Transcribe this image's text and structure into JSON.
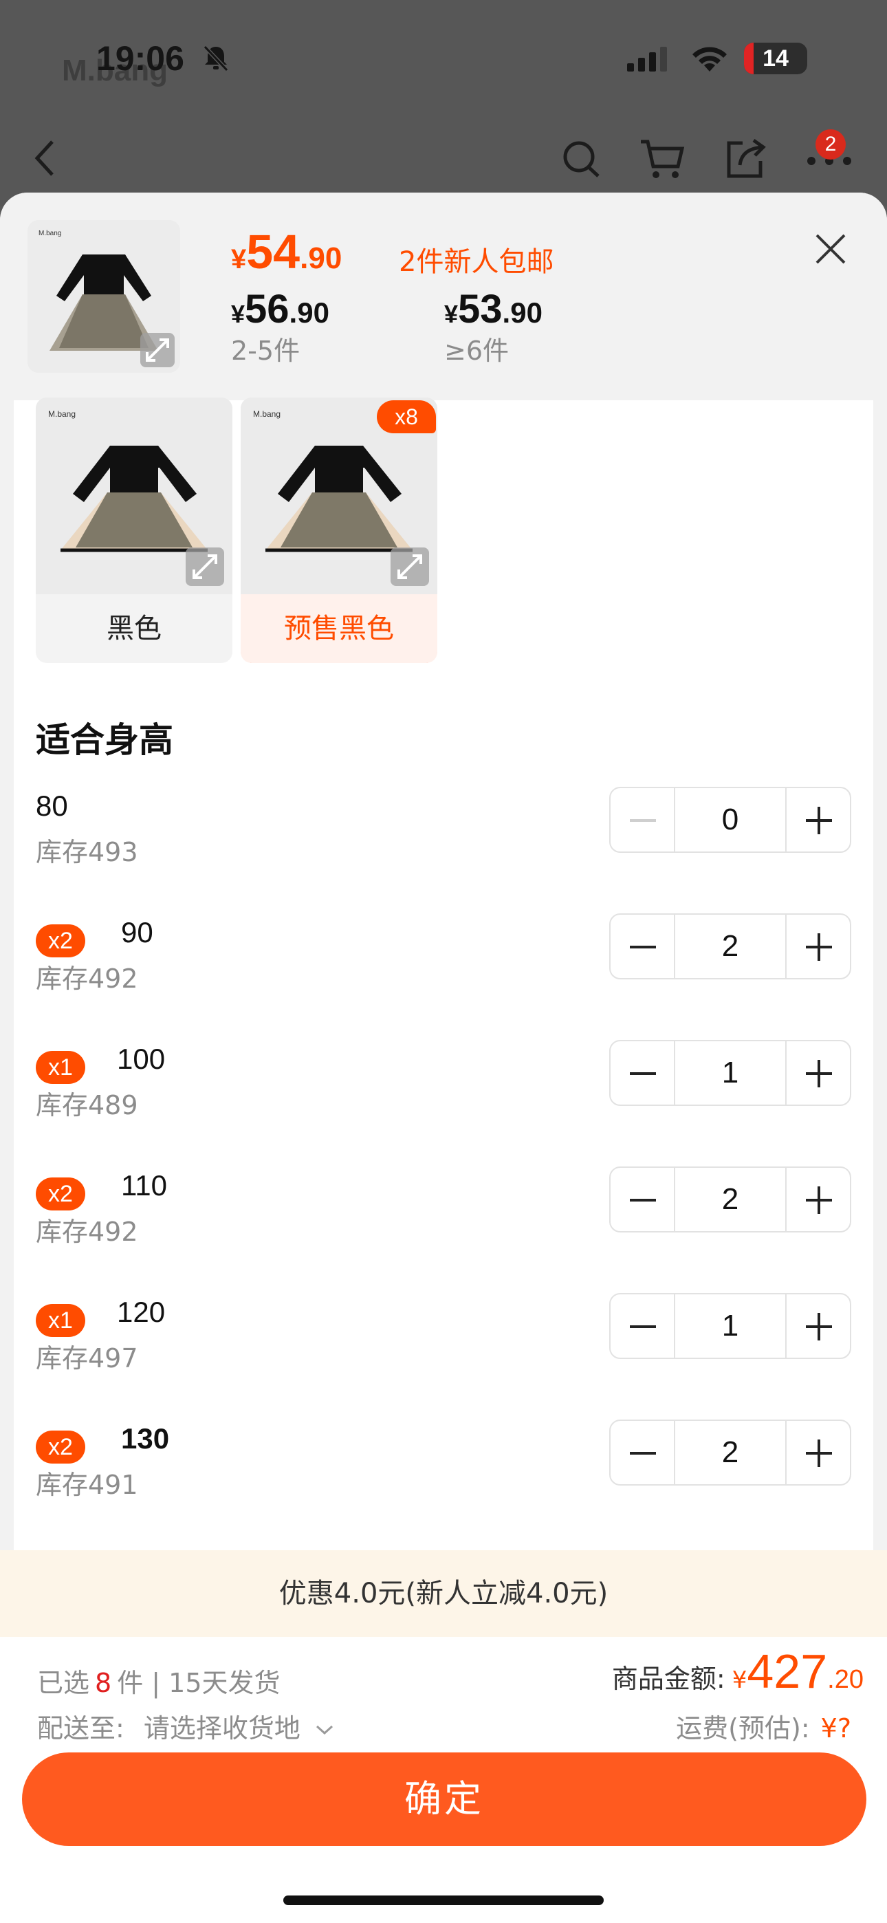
{
  "status": {
    "time": "19:06",
    "battery": "14"
  },
  "background": {
    "brand": "M.bang",
    "cart_badge": "2"
  },
  "header": {
    "price_yen": "¥",
    "price_int": "54",
    "price_dec": ".90",
    "promo_note": "2件新人包邮",
    "tiers": [
      {
        "yen": "¥",
        "int": "56",
        "dec": ".90",
        "qty": "2-5件"
      },
      {
        "yen": "¥",
        "int": "53",
        "dec": ".90",
        "qty": "≥6件"
      }
    ]
  },
  "variants": [
    {
      "label": "黑色",
      "selected": false
    },
    {
      "label": "预售黑色",
      "selected": true,
      "count": "x8"
    }
  ],
  "size_section": {
    "title": "适合身高",
    "rows": [
      {
        "tag": "",
        "size": "80",
        "stock": "库存493",
        "qty": "0"
      },
      {
        "tag": "x2",
        "size": "90",
        "stock": "库存492",
        "qty": "2"
      },
      {
        "tag": "x1",
        "size": "100",
        "stock": "库存489",
        "qty": "1"
      },
      {
        "tag": "x2",
        "size": "110",
        "stock": "库存492",
        "qty": "2"
      },
      {
        "tag": "x1",
        "size": "120",
        "stock": "库存497",
        "qty": "1"
      },
      {
        "tag": "x2",
        "size": "130",
        "stock": "库存491",
        "qty": "2"
      }
    ]
  },
  "discount": "优惠4.0元(新人立减4.0元)",
  "summary": {
    "selected_prefix": "已选",
    "selected_count": "8",
    "selected_suffix": "件 | 15天发货",
    "ship_to_label": "配送至:",
    "ship_to_value": "请选择收货地",
    "amount_label": "商品金额:",
    "amount_yen": "¥",
    "amount_int": "427",
    "amount_dec": ".20",
    "freight_label": "运费(预估):",
    "freight_value": "¥?"
  },
  "confirm_label": "确定",
  "colors": {
    "accent": "#ff4c00",
    "button": "#ff5a1f",
    "discount_bg": "#fdf5e8"
  }
}
